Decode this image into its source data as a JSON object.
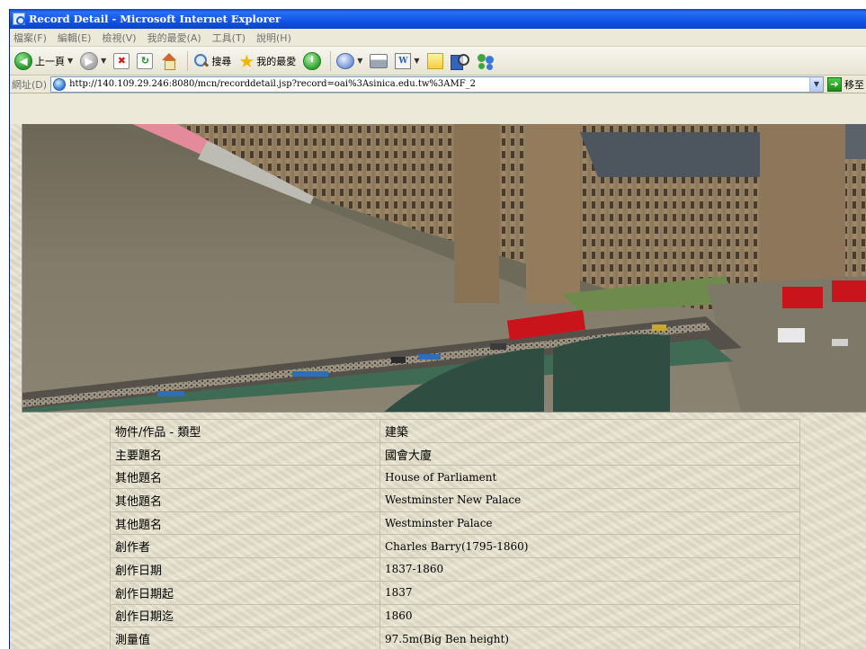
{
  "window": {
    "title": "Record Detail - Microsoft Internet Explorer"
  },
  "menu": [
    "檔案(F)",
    "編輯(E)",
    "檢視(V)",
    "我的最愛(A)",
    "工具(T)",
    "說明(H)"
  ],
  "toolbar": {
    "back_label": "上一頁",
    "search_label": "搜尋",
    "favorites_label": "我的最愛"
  },
  "address": {
    "label": "網址(D)",
    "url": "http://140.109.29.246:8080/mcn/recorddetail.jsp?record=oai%3Asinica.edu.tw%3AMF_2",
    "go_label": "移至"
  },
  "record": {
    "rows": [
      {
        "label": "物件/作品 - 類型",
        "value": "建築"
      },
      {
        "label": "主要題名",
        "value": "國會大廈"
      },
      {
        "label": "其他題名",
        "value": "House of Parliament"
      },
      {
        "label": "其他題名",
        "value": "Westminster New Palace"
      },
      {
        "label": "其他題名",
        "value": "Westminster Palace"
      },
      {
        "label": "創作者",
        "value": "Charles Barry(1795-1860)"
      },
      {
        "label": "創作日期",
        "value": "1837-1860"
      },
      {
        "label": "創作日期起",
        "value": "1837"
      },
      {
        "label": "創作日期迄",
        "value": "1860"
      },
      {
        "label": "測量值",
        "value": "97.5m(Big Ben height)"
      }
    ]
  },
  "colors": {
    "titlebar": "#1155e6",
    "page_background": "#e6e1cc",
    "river": "#7d7563",
    "building_stone": "#9b8466",
    "bus_red": "#c8141a"
  }
}
